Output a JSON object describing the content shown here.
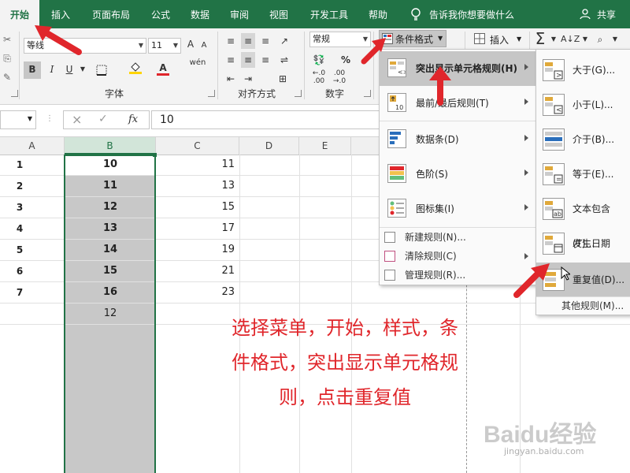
{
  "tabs": [
    "开始",
    "插入",
    "页面布局",
    "公式",
    "数据",
    "审阅",
    "视图",
    "开发工具",
    "帮助"
  ],
  "tell_me": "告诉我你想要做什么",
  "share": "共享",
  "font": {
    "name": "等线",
    "size": "11",
    "bold": "B",
    "italic": "I",
    "underline": "U",
    "wen": "wén",
    "group_label": "字体"
  },
  "alignment": {
    "group_label": "对齐方式"
  },
  "number": {
    "format": "常规",
    "percent": "%",
    "group_label": "数字"
  },
  "styles": {
    "conditional_format": "条件格式"
  },
  "cells": {
    "insert": "插入"
  },
  "editing": {
    "sum": "Σ"
  },
  "formula_bar": {
    "fx": "fx",
    "value": "10",
    "cancel": "×",
    "enter": "✓"
  },
  "columns": [
    "A",
    "B",
    "C",
    "D",
    "E"
  ],
  "rows": [
    {
      "num": "1",
      "b": "10",
      "c": "11"
    },
    {
      "num": "2",
      "b": "11",
      "c": "13"
    },
    {
      "num": "3",
      "b": "12",
      "c": "15"
    },
    {
      "num": "4",
      "b": "13",
      "c": "17"
    },
    {
      "num": "5",
      "b": "14",
      "c": "19"
    },
    {
      "num": "6",
      "b": "15",
      "c": "21"
    },
    {
      "num": "7",
      "b": "16",
      "c": "23"
    },
    {
      "num": "",
      "b": "12",
      "c": ""
    }
  ],
  "cf_menu": {
    "items": [
      "突出显示单元格规则(H)",
      "最前/最后规则(T)",
      "数据条(D)",
      "色阶(S)",
      "图标集(I)"
    ],
    "small": [
      "新建规则(N)...",
      "清除规则(C)",
      "管理规则(R)..."
    ]
  },
  "submenu": {
    "items": [
      "大于(G)...",
      "小于(L)...",
      "介于(B)...",
      "等于(E)...",
      "文本包含(T)...",
      "发生日期(A)...",
      "重复值(D)..."
    ],
    "other": "其他规则(M)..."
  },
  "caption": [
    "选择菜单，开始，样式，条",
    "件格式，突出显示单元格规",
    "则，点击重复值"
  ],
  "watermark": "Baidu经验",
  "watermark_url": "jingyan.baidu.com",
  "colors": {
    "green": "#217346",
    "red": "#e0262b",
    "selection": "#c8c8c8"
  }
}
